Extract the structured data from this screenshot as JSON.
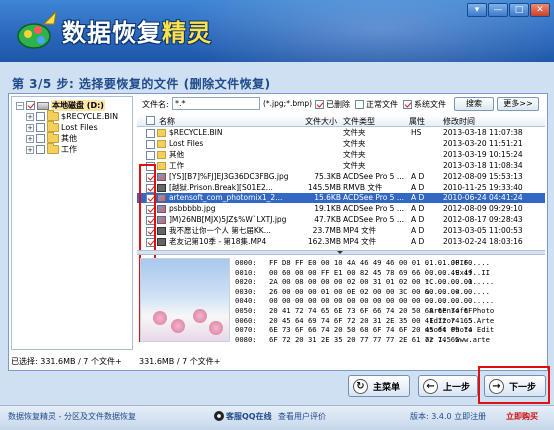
{
  "app": {
    "title_main": "数据恢复",
    "title_accent": "精灵",
    "window_buttons": [
      "▾",
      "—",
      "□",
      "✕"
    ]
  },
  "step_title": "第 3/5 步: 选择要恢复的文件 (删除文件恢复)",
  "tree": [
    {
      "label": "本地磁盘 (D:)",
      "expander": "−",
      "checked": true,
      "icon": "drive-icon",
      "selected": true
    },
    {
      "label": "$RECYCLE.BIN",
      "expander": "+",
      "checked": false,
      "icon": "folder-icon"
    },
    {
      "label": "Lost Files",
      "expander": "+",
      "checked": false,
      "icon": "folder-icon"
    },
    {
      "label": "其他",
      "expander": "+",
      "checked": false,
      "icon": "folder-icon"
    },
    {
      "label": "工作",
      "expander": "+",
      "checked": false,
      "icon": "folder-icon"
    }
  ],
  "filter": {
    "label": "文件名:",
    "value": "*.*",
    "hint": "(*.jpg;*.bmp)",
    "options": [
      {
        "label": "已删除",
        "checked": true
      },
      {
        "label": "正常文件",
        "checked": false
      },
      {
        "label": "系统文件",
        "checked": true
      }
    ],
    "search_button": "搜索",
    "more_button": "更多>>"
  },
  "columns": [
    "名称",
    "文件大小",
    "文件类型",
    "属性",
    "修改时间"
  ],
  "files": [
    {
      "name": "$RECYCLE.BIN",
      "size": "",
      "type": "文件夹",
      "attr": "HS",
      "time": "2013-03-18 11:07:38",
      "icon": "folder-icon",
      "checked": false,
      "selected": false
    },
    {
      "name": "Lost Files",
      "size": "",
      "type": "文件夹",
      "attr": "",
      "time": "2013-03-20 11:51:21",
      "icon": "folder-icon",
      "checked": false,
      "selected": false
    },
    {
      "name": "其他",
      "size": "",
      "type": "文件夹",
      "attr": "",
      "time": "2013-03-19 10:15:24",
      "icon": "folder-icon",
      "checked": false,
      "selected": false
    },
    {
      "name": "工作",
      "size": "",
      "type": "文件夹",
      "attr": "",
      "time": "2013-03-18 11:08:34",
      "icon": "folder-icon",
      "checked": false,
      "selected": false
    },
    {
      "name": "[YS][B7]%FJ]EJ3G36DC3FBG.jpg",
      "size": "75.3KB",
      "type": "ACDSee Pro 5 ...",
      "attr": "A D",
      "time": "2012-08-09 15:53:13",
      "icon": "image-file-icon",
      "checked": true,
      "selected": false
    },
    {
      "name": "[越狱.Prison.Break][S01E2...",
      "size": "145.5MB",
      "type": "RMVB 文件",
      "attr": "A D",
      "time": "2010-11-25 19:33:40",
      "icon": "video-file-icon",
      "checked": true,
      "selected": false
    },
    {
      "name": "artensoft_com_photomix1_2...",
      "size": "15.6KB",
      "type": "ACDSee Pro 5 ...",
      "attr": "A D",
      "time": "2010-06-24 04:41:24",
      "icon": "image-file-icon",
      "checked": true,
      "selected": true
    },
    {
      "name": "psbbbbb.jpg",
      "size": "19.1KB",
      "type": "ACDSee Pro 5 ...",
      "attr": "A D",
      "time": "2012-08-09 09:29:10",
      "icon": "image-file-icon",
      "checked": true,
      "selected": false
    },
    {
      "name": "]M)26NB[MJX)5JZ$%W`LXTJ.jpg",
      "size": "47.7KB",
      "type": "ACDSee Pro 5 ...",
      "attr": "A D",
      "time": "2012-08-17 09:28:43",
      "icon": "image-file-icon",
      "checked": true,
      "selected": false
    },
    {
      "name": "我不愿让你一个人 第七届KK...",
      "size": "23.7MB",
      "type": "MP4 文件",
      "attr": "A D",
      "time": "2013-03-05 11:00:53",
      "icon": "video-file-icon",
      "checked": true,
      "selected": false
    },
    {
      "name": "老友记第10季 - 第18集.MP4",
      "size": "162.3MB",
      "type": "MP4 文件",
      "attr": "A D",
      "time": "2013-02-24 18:03:16",
      "icon": "video-file-icon",
      "checked": true,
      "selected": false
    }
  ],
  "hex": [
    {
      "off": "0000:",
      "bytes": "FF D8 FF E0 00 10 4A 46 49 46 00 01 01 01 00 60",
      "ascii": "......JFIF....."
    },
    {
      "off": "0010:",
      "bytes": "00 60 00 00 FF E1 00 82 45 78 69 66 00 00 49 49",
      "ascii": "`......Exif..II"
    },
    {
      "off": "0020:",
      "bytes": "2A 00 08 00 00 00 02 00 31 01 02 00 1C 00 00 00",
      "ascii": "*.........1....."
    },
    {
      "off": "0030:",
      "bytes": "26 00 00 00 01 00 0E 02 00 00 3C 00 00 00 00 00",
      "ascii": "&......<......."
    },
    {
      "off": "0040:",
      "bytes": "00 00 00 00 00 00 00 00 00 00 00 00 00 00 00 00",
      "ascii": "................"
    },
    {
      "off": "0050:",
      "bytes": "20 41 72 74 65 6E 73 6F 66 74 20 50 68 6F 74 6F",
      "ascii": " Artensoft Photo"
    },
    {
      "off": "0060:",
      "bytes": "20 45 64 69 74 6F 72 20 31 2E 35 00 41 72 74 65",
      "ascii": " Editor 1.5.Arte"
    },
    {
      "off": "0070:",
      "bytes": "6E 73 6F 66 74 20 50 68 6F 74 6F 20 45 64 69 74",
      "ascii": "nsoft Photo Edit"
    },
    {
      "off": "0080:",
      "bytes": "6F 72 20 31 2E 35 20 77 77 77 2E 61 72 74 65",
      "ascii": "or 1.5 www.arte"
    }
  ],
  "status": {
    "selected_left": "已选择: 331.6MB / 7 个文件+",
    "selected_right": "331.6MB / 7 个文件+"
  },
  "buttons": {
    "main_menu": "主菜单",
    "prev": "上一步",
    "next": "下一步"
  },
  "footer": {
    "left": "数据恢复精灵 - 分区及文件数据恢复",
    "qq": "客服QQ在线",
    "reviews": "查看用户评价",
    "version": "版本: 3.4.0 立即注册",
    "buy": "立即购买"
  },
  "colors": {
    "header": "#2a68bd",
    "selection": "#3268c4",
    "highlight_box": "#e01010",
    "footer_link": "#d01010"
  }
}
